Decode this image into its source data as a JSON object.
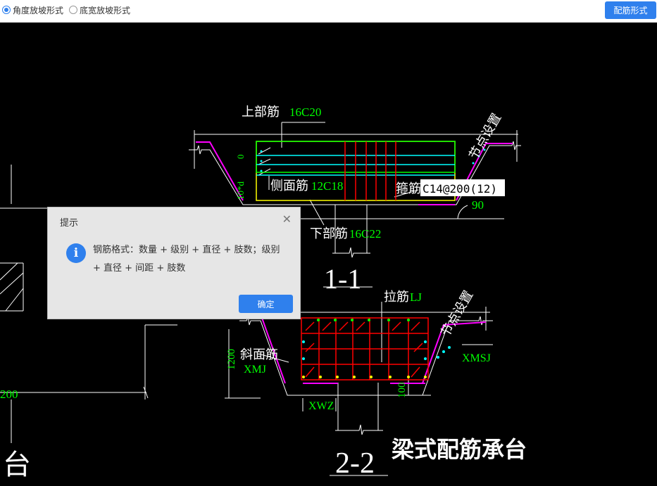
{
  "toolbar": {
    "radio_angle": "角度放坡形式",
    "radio_width": "底宽放坡形式",
    "selected": "angle",
    "config_button": "配筋形式"
  },
  "drawing": {
    "top_bar_label": "上部筋",
    "top_bar_value": "16C20",
    "node_setting": "节点设置",
    "dim_zero": "0",
    "dim_10d": "10*d",
    "side_bar_label": "侧面筋",
    "side_bar_value": "12C18",
    "stirrup_label": "箍筋",
    "stirrup_value": "C14@200(12)",
    "angle_value": "90",
    "bottom_bar_label": "下部筋",
    "bottom_bar_value": "16C22",
    "section_1": "1-1",
    "tie_bar_label": "拉筋",
    "tie_bar_value": "LJ",
    "node_setting_2": "节点设置",
    "xmsj": "XMSJ",
    "dim_1200": "1200",
    "slope_bar_label": "斜面筋",
    "xmj": "XMJ",
    "dim_100": "100",
    "xwz": "XWZ",
    "section_2": "2-2",
    "caption": "梁式配筋承台",
    "left_dim": "200",
    "left_tai": "台"
  },
  "dialog": {
    "title": "提示",
    "message": "钢筋格式：数量 + 级别 + 直径 + 肢数；级别 + 直径 + 间距 + 肢数",
    "ok_button": "确定"
  },
  "colors": {
    "green": "#00ff00",
    "white": "#ffffff",
    "red": "#ff0000",
    "magenta": "#ff00ff",
    "yellow": "#ffff00",
    "cyan": "#00ffff",
    "accent": "#2f80ed"
  }
}
